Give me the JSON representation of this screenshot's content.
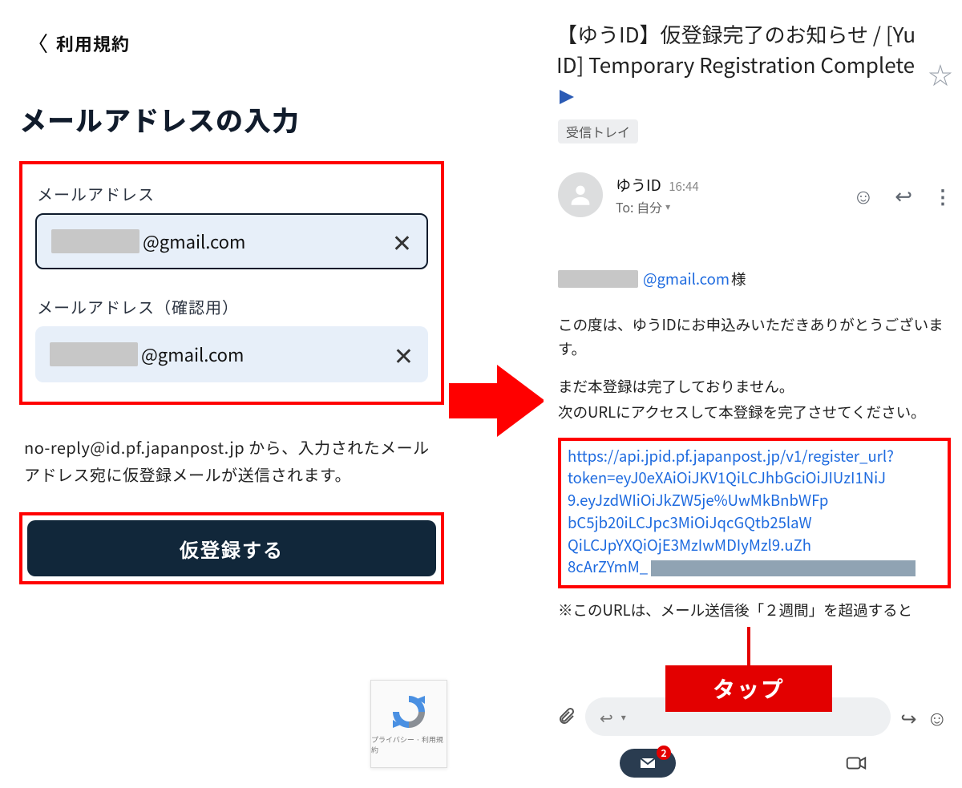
{
  "left": {
    "back_label": "利用規約",
    "title": "メールアドレスの入力",
    "field1_label": "メールアドレス",
    "field2_label": "メールアドレス（確認用）",
    "email_domain": "@gmail.com",
    "hint": "no-reply@id.pf.japanpost.jp から、入力されたメールアドレス宛に仮登録メールが送信されます。",
    "submit_label": "仮登録する",
    "recaptcha_footer": "プライバシー · 利用規約"
  },
  "right": {
    "subject": "【ゆうID】仮登録完了のお知らせ / [Yu ID] Temporary Registration Complete",
    "inbox_label": "受信トレイ",
    "sender_name": "ゆうID",
    "sender_time": "16:44",
    "to_label": "To: 自分",
    "recipient_domain": "@gmail.com",
    "recipient_suffix": " 様",
    "body_line1": "この度は、ゆうIDにお申込みいただきありがとうございます。",
    "body_line2": "まだ本登録は完了しておりません。",
    "body_line3": "次のURLにアクセスして本登録を完了させてください。",
    "url_l1": "https://api.jpid.pf.japanpost.jp/v1/register_url?",
    "url_l2": "token=eyJ0eXAiOiJKV1QiLCJhbGciOiJIUzI1NiJ",
    "url_l3": "9.eyJzdWIiOiJkZW5je%UwMkBnbWFp",
    "url_l4": "bC5jb20iLCJpc3MiOiJqcGQtb25laW",
    "url_l5": "QiLCJpYXQiOjE3MzIwMDIyMzl9.uZh",
    "url_l6": "8cArZYmM_",
    "note_prefix": "※",
    "note_text": "このURLは、メール送信後「２週間」を超過すると",
    "nav_badge": "2"
  },
  "callout": {
    "tap": "タップ"
  }
}
